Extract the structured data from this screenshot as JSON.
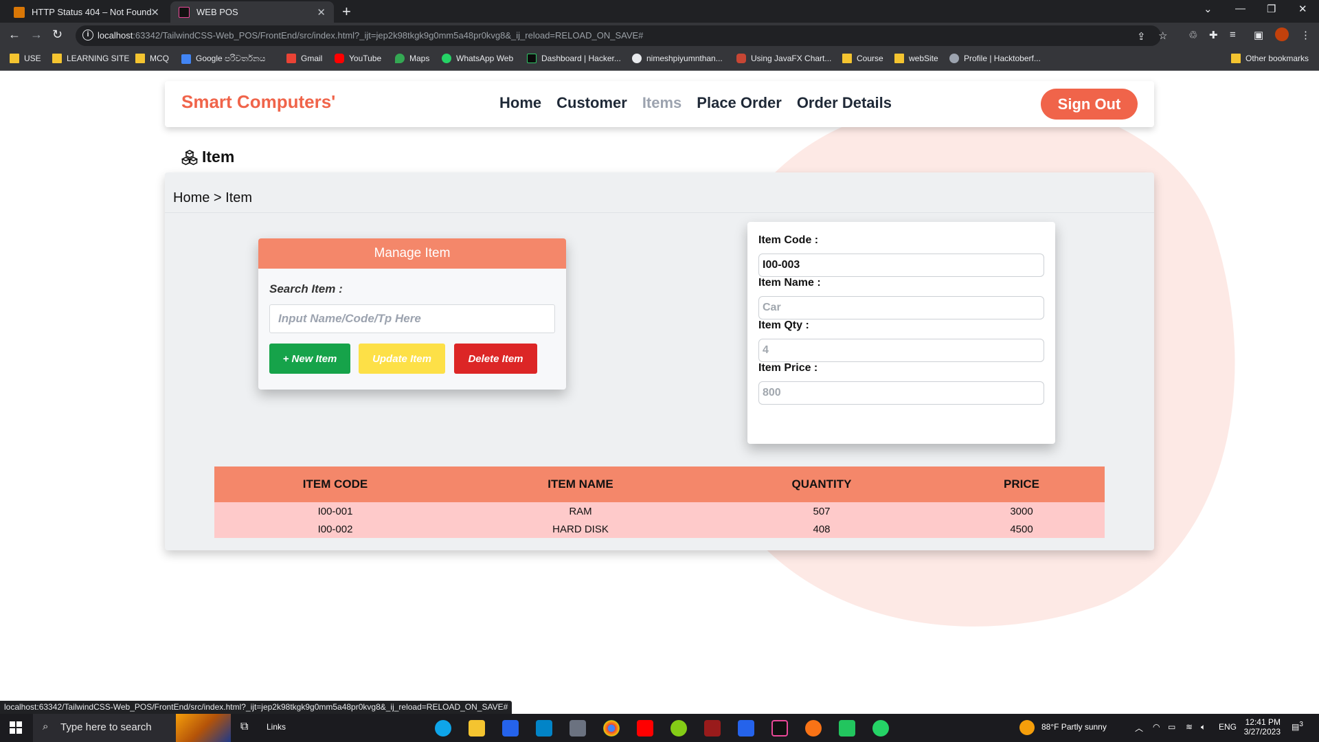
{
  "browser": {
    "tabs": [
      {
        "title": "HTTP Status 404 – Not Found"
      },
      {
        "title": "WEB POS"
      }
    ],
    "url_host": "localhost",
    "url_rest": ":63342/TailwindCSS-Web_POS/FrontEnd/src/index.html?_ijt=jep2k98tkgk9g0mm5a48pr0kvg8&_ij_reload=RELOAD_ON_SAVE#",
    "bookmarks": [
      "USE",
      "LEARNING SITE",
      "MCQ",
      "Google පරිවර්තනය",
      "Gmail",
      "YouTube",
      "Maps",
      "WhatsApp Web",
      "Dashboard | Hacker...",
      "nimeshpiyumnthan...",
      "Using JavaFX Chart...",
      "Course",
      "webSite",
      "Profile | Hacktoberf..."
    ],
    "other_bookmarks": "Other bookmarks",
    "status_url": "localhost:63342/TailwindCSS-Web_POS/FrontEnd/src/index.html?_ijt=jep2k98tkgk9g0mm5a48pr0kvg8&_ij_reload=RELOAD_ON_SAVE#"
  },
  "header": {
    "brand": "Smart Computers'",
    "nav": [
      "Home",
      "Customer",
      "Items",
      "Place Order",
      "Order Details"
    ],
    "active_nav": "Items",
    "signout": "Sign Out"
  },
  "section": {
    "title": "Item",
    "breadcrumb": "Home > Item"
  },
  "manage": {
    "title": "Manage Item",
    "search_label": "Search Item :",
    "search_placeholder": "Input Name/Code/Tp Here",
    "btn_new": "+ New Item",
    "btn_update": "Update Item",
    "btn_delete": "Delete Item"
  },
  "form": {
    "code_label": "Item Code :",
    "code_value": "I00-003",
    "name_label": "Item Name :",
    "name_placeholder": "Car",
    "qty_label": "Item Qty :",
    "qty_placeholder": "4",
    "price_label": "Item Price :",
    "price_placeholder": "800"
  },
  "table": {
    "headers": [
      "ITEM CODE",
      "ITEM NAME",
      "QUANTITY",
      "PRICE"
    ],
    "rows": [
      [
        "I00-001",
        "RAM",
        "507",
        "3000"
      ],
      [
        "I00-002",
        "HARD DISK",
        "408",
        "4500"
      ]
    ]
  },
  "taskbar": {
    "search_text": "Type here to search",
    "links": "Links",
    "weather": "88°F  Partly sunny",
    "lang": "ENG",
    "time": "12:41 PM",
    "date": "3/27/2023",
    "notif_count": "3"
  },
  "colors": {
    "brand": "#f0644a",
    "accent": "#f4876a",
    "row_bg": "#fecaca",
    "btn_new": "#16a34a",
    "btn_update": "#fde047",
    "btn_delete": "#dc2626"
  }
}
